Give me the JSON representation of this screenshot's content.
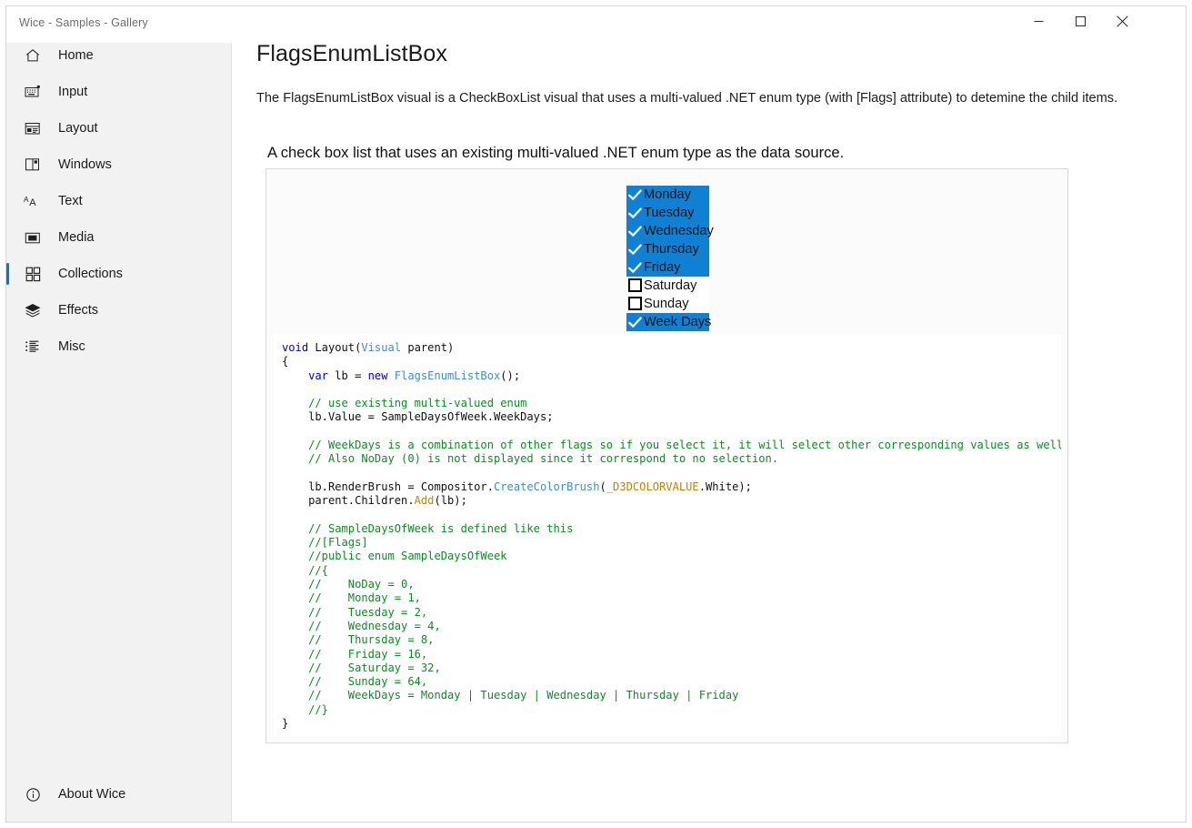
{
  "window": {
    "title": "Wice - Samples - Gallery",
    "controls": {
      "minimize": "minimize-button",
      "maximize": "maximize-button",
      "close": "close-button"
    }
  },
  "sidebar": {
    "items": [
      {
        "label": "Home",
        "icon": "home-icon",
        "selected": false
      },
      {
        "label": "Input",
        "icon": "keyboard-icon",
        "selected": false
      },
      {
        "label": "Layout",
        "icon": "layout-icon",
        "selected": false
      },
      {
        "label": "Windows",
        "icon": "windows-icon",
        "selected": false
      },
      {
        "label": "Text",
        "icon": "text-aa-icon",
        "selected": false
      },
      {
        "label": "Media",
        "icon": "media-icon",
        "selected": false
      },
      {
        "label": "Collections",
        "icon": "collections-icon",
        "selected": true
      },
      {
        "label": "Effects",
        "icon": "layers-icon",
        "selected": false
      },
      {
        "label": "Misc",
        "icon": "list-icon",
        "selected": false
      }
    ],
    "footer": {
      "label": "About Wice",
      "icon": "info-icon"
    },
    "accent_color": "#0078d4"
  },
  "main": {
    "title": "FlagsEnumListBox",
    "description": "The FlagsEnumListBox visual is a CheckBoxList visual that uses a multi-valued .NET enum type (with [Flags] attribute) to detemine the child items.",
    "sample_heading": "A check box list that uses an existing multi-valued .NET enum type as the data source."
  },
  "demo": {
    "listbox": {
      "checked_background": "#0e81d4",
      "unchecked_background": "#ffffff",
      "items": [
        {
          "label": "Monday",
          "checked": true
        },
        {
          "label": "Tuesday",
          "checked": true
        },
        {
          "label": "Wednesday",
          "checked": true
        },
        {
          "label": "Thursday",
          "checked": true
        },
        {
          "label": "Friday",
          "checked": true
        },
        {
          "label": "Saturday",
          "checked": false
        },
        {
          "label": "Sunday",
          "checked": false
        },
        {
          "label": "Week Days",
          "checked": true
        }
      ]
    },
    "code": {
      "language": "csharp",
      "lines": [
        [
          {
            "t": "void",
            "c": "kw"
          },
          {
            "t": " Layout(",
            "c": "plain"
          },
          {
            "t": "Visual",
            "c": "type"
          },
          {
            "t": " parent)",
            "c": "plain"
          }
        ],
        [
          {
            "t": "{",
            "c": "plain"
          }
        ],
        [
          {
            "t": "    ",
            "c": "plain"
          },
          {
            "t": "var",
            "c": "kw"
          },
          {
            "t": " lb = ",
            "c": "plain"
          },
          {
            "t": "new",
            "c": "kw"
          },
          {
            "t": " ",
            "c": "plain"
          },
          {
            "t": "FlagsEnumListBox",
            "c": "type"
          },
          {
            "t": "();",
            "c": "plain"
          }
        ],
        [
          {
            "t": "",
            "c": "plain"
          }
        ],
        [
          {
            "t": "    ",
            "c": "plain"
          },
          {
            "t": "// use existing multi-valued enum",
            "c": "cmt"
          }
        ],
        [
          {
            "t": "    lb.Value = SampleDaysOfWeek.WeekDays;",
            "c": "plain"
          }
        ],
        [
          {
            "t": "",
            "c": "plain"
          }
        ],
        [
          {
            "t": "    ",
            "c": "plain"
          },
          {
            "t": "// WeekDays is a combination of other flags so if you select it, it will select other corresponding values as well.",
            "c": "cmt"
          }
        ],
        [
          {
            "t": "    ",
            "c": "plain"
          },
          {
            "t": "// Also NoDay (0) is not displayed since it correspond to no selection.",
            "c": "cmt"
          }
        ],
        [
          {
            "t": "",
            "c": "plain"
          }
        ],
        [
          {
            "t": "    lb.RenderBrush = Compositor.",
            "c": "plain"
          },
          {
            "t": "CreateColorBrush",
            "c": "type"
          },
          {
            "t": "(",
            "c": "plain"
          },
          {
            "t": "_D3DCOLORVALUE",
            "c": "mth"
          },
          {
            "t": ".White);",
            "c": "plain"
          }
        ],
        [
          {
            "t": "    parent.Children.",
            "c": "plain"
          },
          {
            "t": "Add",
            "c": "mth"
          },
          {
            "t": "(lb);",
            "c": "plain"
          }
        ],
        [
          {
            "t": "",
            "c": "plain"
          }
        ],
        [
          {
            "t": "    ",
            "c": "plain"
          },
          {
            "t": "// SampleDaysOfWeek is defined like this",
            "c": "cmt"
          }
        ],
        [
          {
            "t": "    ",
            "c": "plain"
          },
          {
            "t": "//[Flags]",
            "c": "cmt"
          }
        ],
        [
          {
            "t": "    ",
            "c": "plain"
          },
          {
            "t": "//public enum SampleDaysOfWeek",
            "c": "cmt"
          }
        ],
        [
          {
            "t": "    ",
            "c": "plain"
          },
          {
            "t": "//{",
            "c": "cmt"
          }
        ],
        [
          {
            "t": "    ",
            "c": "plain"
          },
          {
            "t": "//    NoDay = 0,",
            "c": "cmt"
          }
        ],
        [
          {
            "t": "    ",
            "c": "plain"
          },
          {
            "t": "//    Monday = 1,",
            "c": "cmt"
          }
        ],
        [
          {
            "t": "    ",
            "c": "plain"
          },
          {
            "t": "//    Tuesday = 2,",
            "c": "cmt"
          }
        ],
        [
          {
            "t": "    ",
            "c": "plain"
          },
          {
            "t": "//    Wednesday = 4,",
            "c": "cmt"
          }
        ],
        [
          {
            "t": "    ",
            "c": "plain"
          },
          {
            "t": "//    Thursday = 8,",
            "c": "cmt"
          }
        ],
        [
          {
            "t": "    ",
            "c": "plain"
          },
          {
            "t": "//    Friday = 16,",
            "c": "cmt"
          }
        ],
        [
          {
            "t": "    ",
            "c": "plain"
          },
          {
            "t": "//    Saturday = 32,",
            "c": "cmt"
          }
        ],
        [
          {
            "t": "    ",
            "c": "plain"
          },
          {
            "t": "//    Sunday = 64,",
            "c": "cmt"
          }
        ],
        [
          {
            "t": "    ",
            "c": "plain"
          },
          {
            "t": "//    WeekDays = Monday | Tuesday | Wednesday | Thursday | Friday",
            "c": "cmt"
          }
        ],
        [
          {
            "t": "    ",
            "c": "plain"
          },
          {
            "t": "//}",
            "c": "cmt"
          }
        ],
        [
          {
            "t": "}",
            "c": "plain"
          }
        ]
      ]
    }
  }
}
